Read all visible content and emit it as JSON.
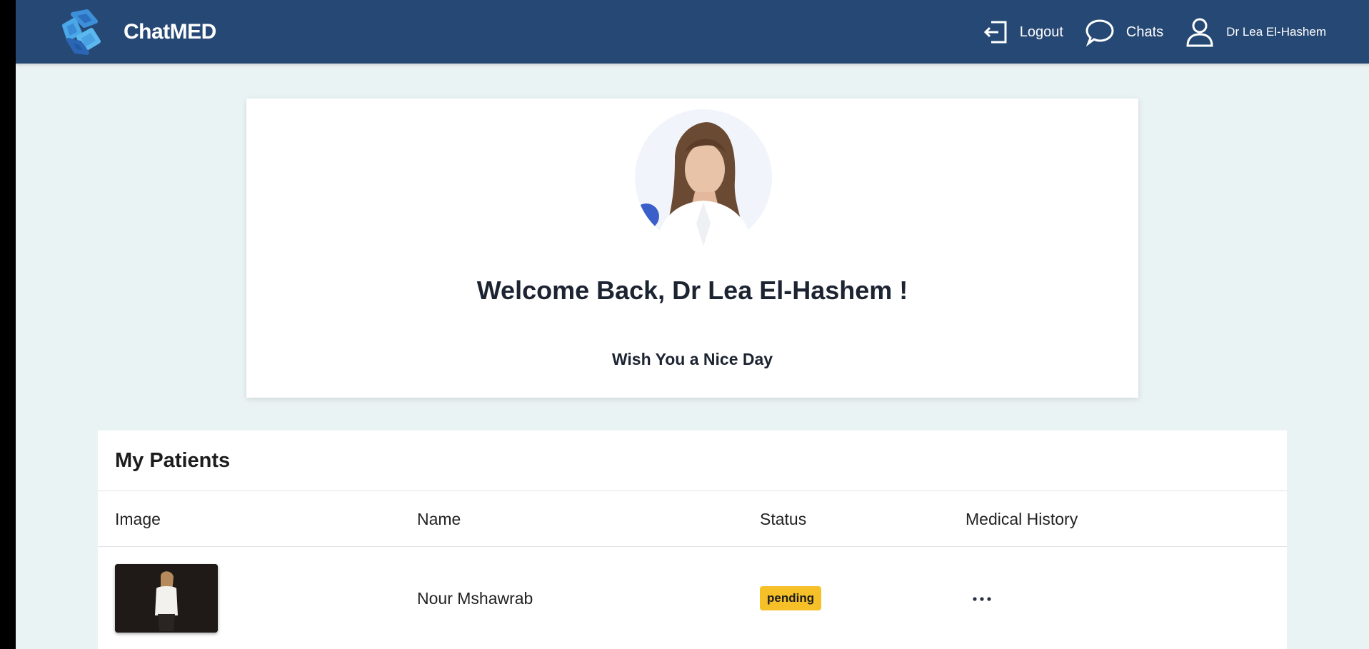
{
  "app": {
    "name": "ChatMED"
  },
  "nav": {
    "logout_label": "Logout",
    "chats_label": "Chats",
    "user_name": "Dr Lea El-Hashem"
  },
  "welcome": {
    "title": "Welcome Back, Dr Lea El-Hashem !",
    "subtitle": "Wish You a Nice Day"
  },
  "patients": {
    "heading": "My Patients",
    "columns": [
      "Image",
      "Name",
      "Status",
      "Medical History"
    ],
    "rows": [
      {
        "name": "Nour Mshawrab",
        "status": "pending"
      }
    ]
  },
  "colors": {
    "navbar": "#264874",
    "page_bg": "#eaf3f4",
    "status_pending": "#f6c029"
  },
  "icons": [
    "logo-icon",
    "logout-icon",
    "chat-icon",
    "user-icon",
    "more-icon"
  ]
}
